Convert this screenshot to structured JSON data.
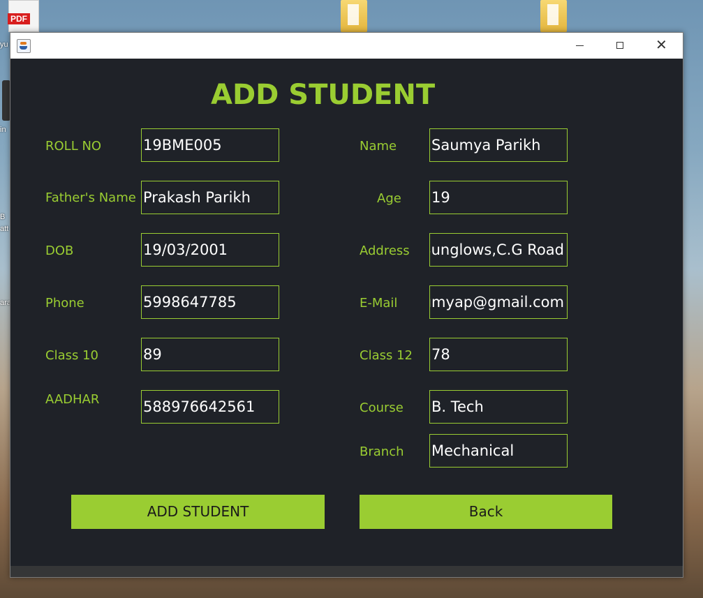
{
  "desktop": {
    "pdf_label": "PDF",
    "side_labels": [
      "yu",
      "in",
      "B",
      "att",
      "ara"
    ]
  },
  "window": {
    "controls": {
      "minimize": "minimize",
      "maximize": "maximize",
      "close": "✕"
    }
  },
  "form": {
    "title": "ADD STUDENT",
    "left": [
      {
        "label": "ROLL NO",
        "value": "19BME005"
      },
      {
        "label": "Father's Name",
        "value": "Prakash Parikh"
      },
      {
        "label": "DOB",
        "value": "19/03/2001"
      },
      {
        "label": "Phone",
        "value": "5998647785"
      },
      {
        "label": "Class 10",
        "value": "89"
      },
      {
        "label": "AADHAR",
        "value": "588976642561"
      }
    ],
    "right": [
      {
        "label": "Name",
        "value": "Saumya Parikh"
      },
      {
        "label": "Age",
        "value": "19"
      },
      {
        "label": "Address",
        "value": "Bunglows,C.G Road"
      },
      {
        "label": "E-Mail",
        "value": "aumyap@gmail.com"
      },
      {
        "label": "Class 12",
        "value": "78"
      },
      {
        "label": "Course",
        "value": "B. Tech"
      },
      {
        "label": "Branch",
        "value": "Mechanical"
      }
    ],
    "buttons": {
      "add": "ADD STUDENT",
      "back": "Back"
    }
  },
  "colors": {
    "accent": "#9acd32",
    "panel": "#1f2228",
    "field_text": "#ffffff"
  }
}
